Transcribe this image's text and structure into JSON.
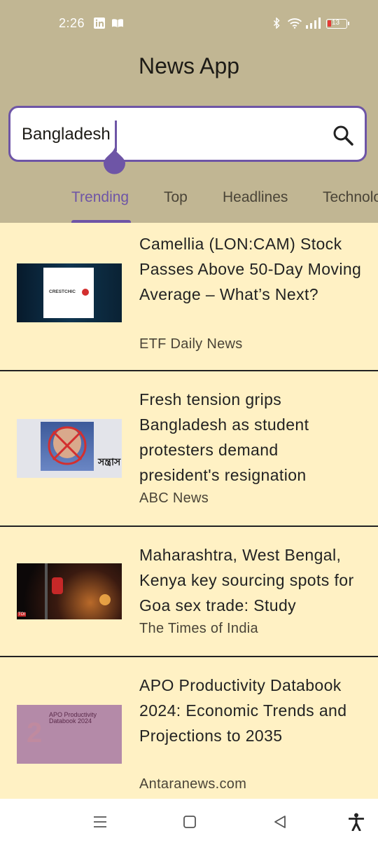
{
  "status_bar": {
    "time": "2:26",
    "battery": "13",
    "icons": [
      "linkedin-icon",
      "book-icon",
      "bluetooth-icon",
      "wifi-icon",
      "signal-icon",
      "battery-icon"
    ]
  },
  "app": {
    "title": "News App"
  },
  "search": {
    "value": "Bangladesh",
    "placeholder": ""
  },
  "tabs": [
    {
      "label": "Trending",
      "active": true
    },
    {
      "label": "Top"
    },
    {
      "label": "Headlines"
    },
    {
      "label": "Technolo"
    }
  ],
  "articles": [
    {
      "title": "Camellia (LON:CAM) Stock Passes Above 50-Day Moving Average – What’s Next?",
      "source": "ETF Daily News",
      "thumb_text": "CRESTCHIC"
    },
    {
      "title": "Fresh tension grips Bangladesh as student protesters demand president's resignation",
      "source": "ABC News",
      "thumb_text": "সন্ত্রাস"
    },
    {
      "title": "Maharashtra, West Bengal, Kenya key sourcing spots for Goa sex trade: Study",
      "source": "The Times of India",
      "thumb_text": "TOI"
    },
    {
      "title": "APO Productivity Databook 2024: Economic Trends and Projections to 2035",
      "source": "Antaranews.com",
      "thumb_text": "APO Productivity Databook 2024"
    }
  ],
  "colors": {
    "header_bg": "#C1B693",
    "list_bg": "#FFF1C4",
    "accent": "#6E55A6"
  },
  "nav_bar": {
    "buttons": [
      "menu-icon",
      "home-square-icon",
      "back-triangle-icon",
      "accessibility-icon"
    ]
  }
}
